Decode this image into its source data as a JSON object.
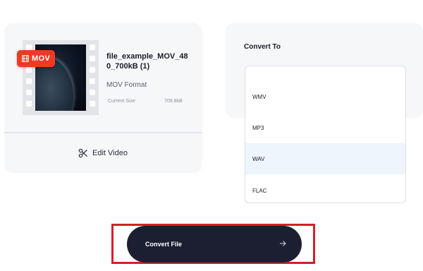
{
  "file_card": {
    "badge_label": "MOV",
    "file_name": "file_example_MOV_480_700kB (1)",
    "format": "MOV Format",
    "size_label": "Current Size",
    "size_value": "709.8kB",
    "edit_label": "Edit Video",
    "icons": {
      "badge": "film-icon",
      "edit": "scissors-icon"
    }
  },
  "convert_to": {
    "title": "Convert To",
    "options": [
      {
        "label": "WMV",
        "selected": false
      },
      {
        "label": "MP3",
        "selected": false
      },
      {
        "label": "WAV",
        "selected": true
      },
      {
        "label": "FLAC",
        "selected": false
      }
    ]
  },
  "action": {
    "label": "Convert File",
    "icon": "arrow-right-icon"
  },
  "colors": {
    "badge": "#ee3a24",
    "button": "#1b1f31",
    "highlight_outline": "#d61f26",
    "selected_option": "#eef5fd"
  }
}
